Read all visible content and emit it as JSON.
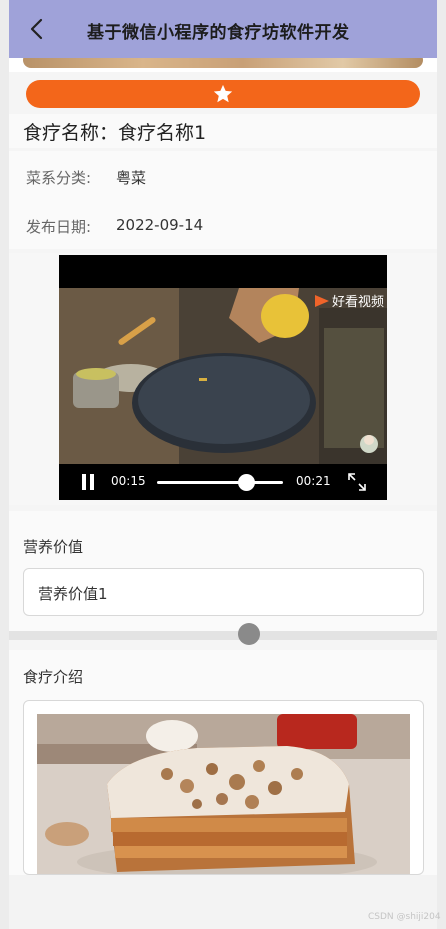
{
  "nav": {
    "title": "基于微信小程序的食疗坊软件开发",
    "back_icon": "chevron-left-icon"
  },
  "favorite": {
    "icon": "star-icon",
    "color": "#f3661a"
  },
  "food": {
    "name_label": "食疗名称：",
    "name_value": "食疗名称1",
    "cuisine_label": "菜系分类:",
    "cuisine_value": "粤菜",
    "date_label": "发布日期:",
    "date_value": "2022-09-14"
  },
  "video": {
    "logo_text": "好看视频",
    "current_time": "00:15",
    "end_time": "00:21",
    "progress": 0.71
  },
  "nutrition": {
    "label": "营养价值",
    "value": "营养价值1"
  },
  "intro": {
    "label": "食疗介绍"
  },
  "watermark": "CSDN @shiji204",
  "colors": {
    "navbar": "#9fa2d9",
    "accent": "#f3661a"
  }
}
